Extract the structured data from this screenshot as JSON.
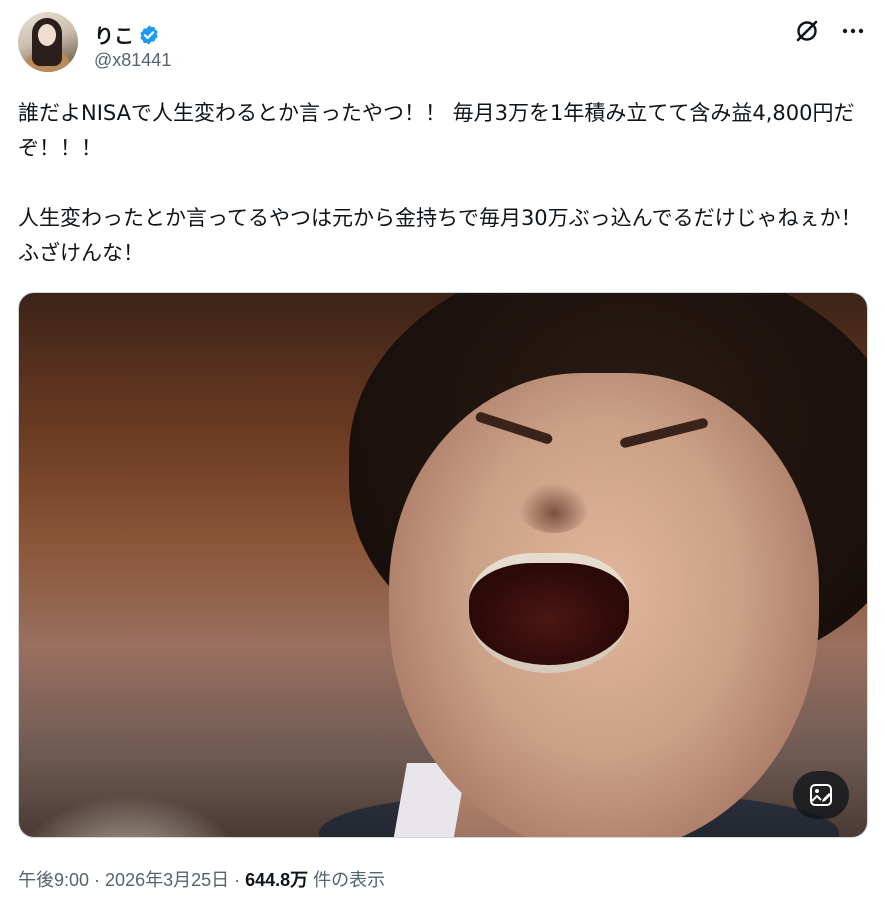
{
  "author": {
    "display_name": "りこ",
    "handle": "@x81441",
    "verified_icon": "verified-badge-icon"
  },
  "actions": {
    "grok_icon": "grok-icon",
    "more_icon": "more-horizontal-icon"
  },
  "tweet": {
    "text": "誰だよNISAで人生変わるとか言ったやつ！！ 毎月3万を1年積み立てて含み益4,800円だぞ！！！\n\n人生変わったとか言ってるやつは元から金持ちで毎月30万ぶっ込んでるだけじゃねぇか！ふざけんな！"
  },
  "media": {
    "type": "photo",
    "badge_icon": "image-edit-icon"
  },
  "meta": {
    "time": "午後9:00",
    "sep1": " · ",
    "date": "2026年3月25日",
    "sep2": " · ",
    "views": "644.8万",
    "views_label": " 件の表示"
  },
  "colors": {
    "text_primary": "#0f1419",
    "text_secondary": "#536471",
    "verified_blue": "#1d9bf0"
  }
}
